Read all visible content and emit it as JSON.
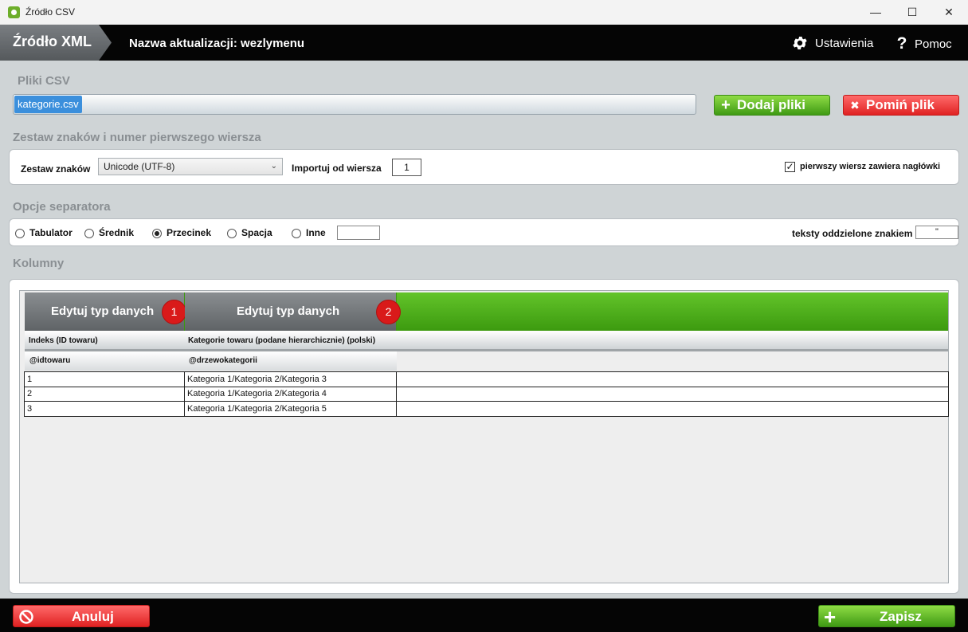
{
  "window": {
    "title": "Źródło CSV",
    "minimize": "—",
    "maximize": "☐",
    "close": "✕"
  },
  "header": {
    "source_tab": "Źródło XML",
    "update_name": "Nazwa aktualizacji: wezlymenu",
    "settings_label": "Ustawienia",
    "help_label": "Pomoc",
    "help_icon": "?"
  },
  "files": {
    "section_title": "Pliki CSV",
    "selected_file": "kategorie.csv",
    "add_button": "Dodaj pliki",
    "add_icon": "+",
    "skip_button": "Pomiń plik",
    "skip_icon": "✖"
  },
  "charset": {
    "section_title": "Zestaw znaków i numer pierwszego wiersza",
    "charset_label": "Zestaw znaków",
    "charset_value": "Unicode (UTF-8)",
    "chevron": "⌄",
    "import_from_label": "Importuj od wiersza",
    "import_from_value": "1",
    "header_checkbox_label": "pierwszy wiersz zawiera nagłówki",
    "header_checkbox_mark": "✓",
    "header_checkbox_checked": true
  },
  "separator": {
    "section_title": "Opcje separatora",
    "options": [
      "Tabulator",
      "Średnik",
      "Przecinek",
      "Spacja",
      "Inne"
    ],
    "selected": "Przecinek",
    "other_value": "",
    "quote_label": "teksty oddzielone znakiem",
    "quote_value": "\""
  },
  "columns": {
    "section_title": "Kolumny",
    "edit_buttons": [
      {
        "label": "Edytuj typ danych",
        "number": "1"
      },
      {
        "label": "Edytuj typ danych",
        "number": "2"
      }
    ],
    "headers": [
      "Indeks (ID towaru)",
      "Kategorie towaru (podane hierarchicznie) (polski)"
    ],
    "variables": [
      "@idtowaru",
      "@drzewokategorii"
    ],
    "rows": [
      [
        "1",
        "Kategoria 1/Kategoria 2/Kategoria 3"
      ],
      [
        "2",
        "Kategoria 1/Kategoria 2/Kategoria 4"
      ],
      [
        "3",
        "Kategoria 1/Kategoria 2/Kategoria 5"
      ]
    ]
  },
  "footer": {
    "cancel_button": "Anuluj",
    "save_button": "Zapisz",
    "save_icon": "+"
  },
  "colors": {
    "accent_green": "#4aab19",
    "danger_red": "#e02222",
    "selection_blue": "#3b8fdc"
  }
}
